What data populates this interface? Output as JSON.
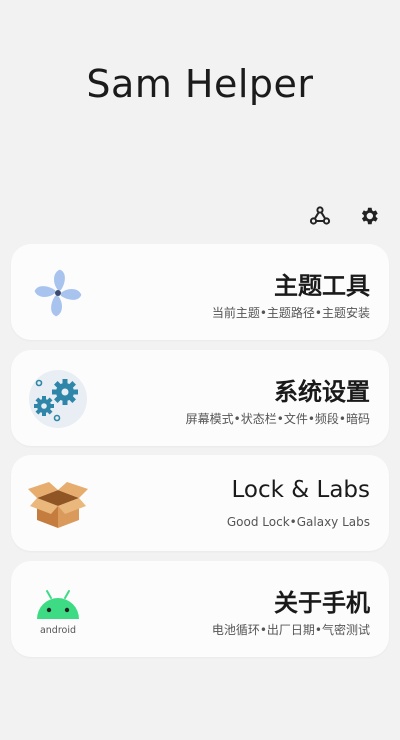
{
  "app": {
    "title": "Sam Helper"
  },
  "toolbar": {
    "share_icon": "share-nodes-icon",
    "settings_icon": "gear-icon"
  },
  "cards": [
    {
      "title": "主题工具",
      "subtitle": "当前主题•主题路径•主题安装",
      "icon": "pinwheel-icon"
    },
    {
      "title": "系统设置",
      "subtitle": "屏幕模式•状态栏•文件•频段•暗码",
      "icon": "gears-icon"
    },
    {
      "title": "Lock & Labs",
      "subtitle": "Good Lock•Galaxy Labs",
      "icon": "open-box-icon"
    },
    {
      "title": "关于手机",
      "subtitle": "电池循环•出厂日期•气密测试",
      "icon": "android-icon",
      "icon_text": "android"
    }
  ],
  "colors": {
    "background": "#f2f2f2",
    "card": "#fcfcfc",
    "pinwheel": "#a8c4ee",
    "gears": "#2f86a9",
    "box": "#d99a5b",
    "android": "#3ddc84"
  }
}
